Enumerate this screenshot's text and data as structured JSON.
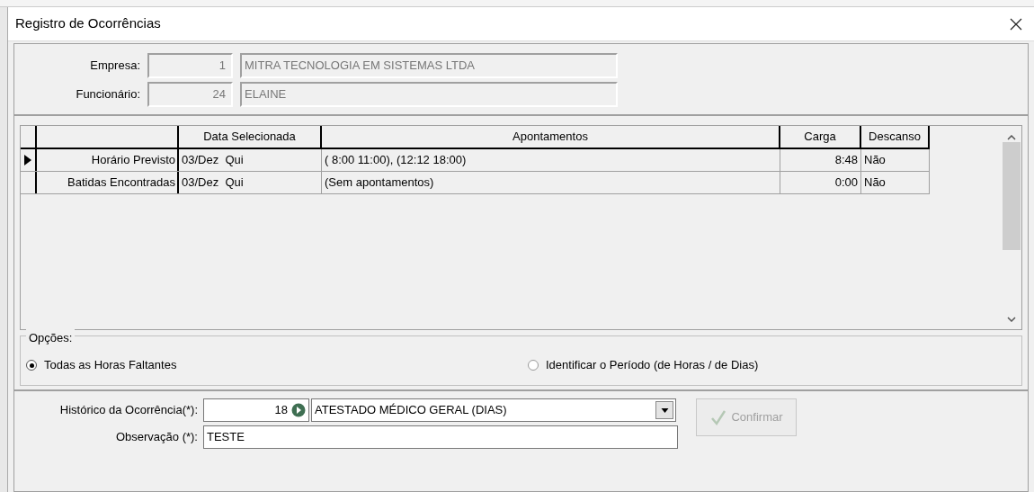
{
  "window": {
    "title": "Registro de Ocorrências"
  },
  "header": {
    "fields": [
      {
        "label": "Empresa:",
        "code": "1",
        "name": "MITRA TECNOLOGIA EM SISTEMAS LTDA"
      },
      {
        "label": "Funcionário:",
        "code": "24",
        "name": "ELAINE"
      }
    ]
  },
  "grid": {
    "columns": [
      "Data Selecionada",
      "Apontamentos",
      "Carga",
      "Descanso"
    ],
    "rows": [
      {
        "label": "Horário Previsto",
        "selected": true,
        "cells": [
          "03/Dez  Qui",
          "( 8:00 11:00), (12:12 18:00)",
          "8:48",
          "Não"
        ]
      },
      {
        "label": "Batidas Encontradas",
        "selected": false,
        "cells": [
          "03/Dez  Qui",
          "(Sem apontamentos)",
          "0:00",
          "Não"
        ]
      }
    ]
  },
  "options": {
    "title": "Opções:",
    "radios": [
      {
        "label": "Todas as Horas Faltantes",
        "selected": true
      },
      {
        "label": "Identificar o Período (de Horas / de Dias)",
        "selected": false
      }
    ]
  },
  "form": {
    "historico": {
      "label": "Histórico da Ocorrência(*):",
      "code": "18",
      "value": "ATESTADO MÉDICO GERAL (DIAS)"
    },
    "observacao": {
      "label": "Observação (*):",
      "value": "TESTE"
    },
    "confirm": {
      "label": "Confirmar",
      "disabled": true
    }
  }
}
